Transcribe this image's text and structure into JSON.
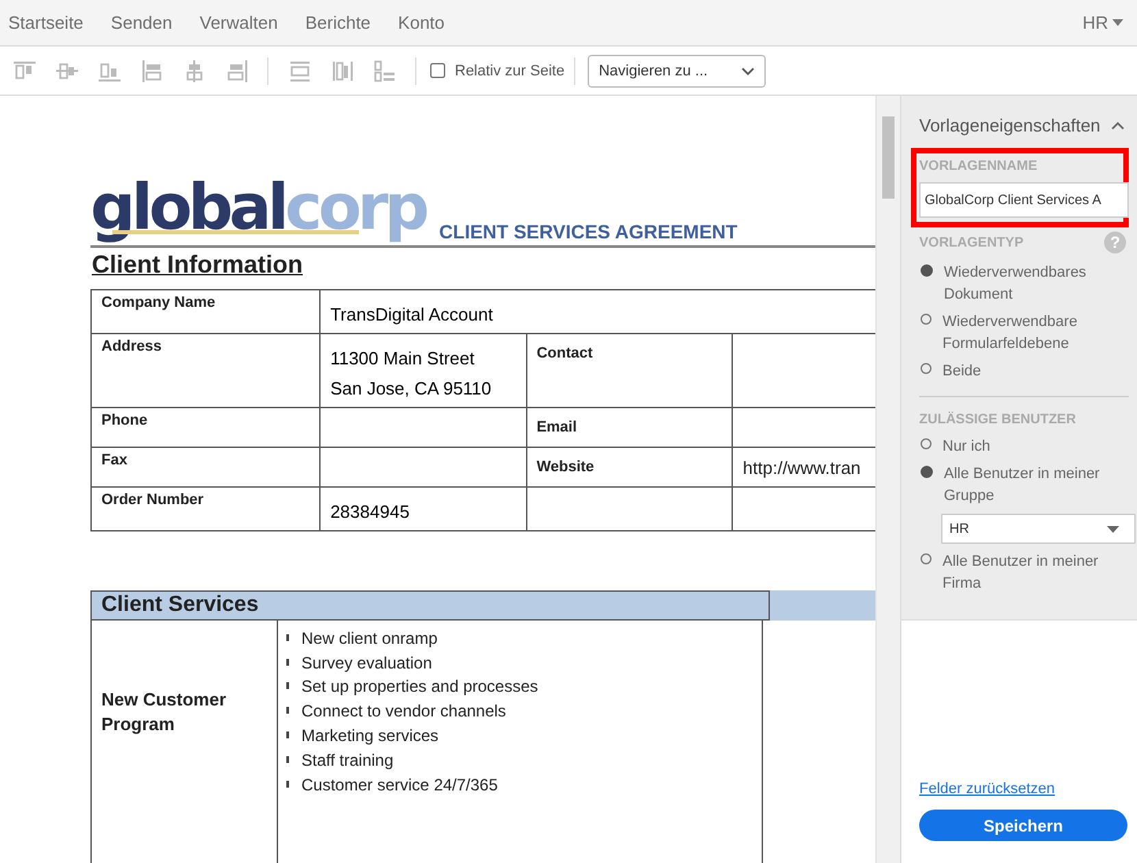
{
  "nav": {
    "items": [
      "Startseite",
      "Senden",
      "Verwalten",
      "Berichte",
      "Konto"
    ],
    "user_menu": "HR"
  },
  "toolbar": {
    "relative_checkbox": {
      "label": "Relativ zur Seite",
      "checked": false
    },
    "navigate_select": "Navigieren zu ..."
  },
  "document": {
    "logo": {
      "part_1": "global",
      "part_2": "corp"
    },
    "title": "CLIENT SERVICES AGREEMENT",
    "section_1": "Client Information",
    "client_info": [
      {
        "kind": "full",
        "label": "Company Name",
        "value": [
          "TransDigital Account"
        ]
      },
      {
        "kind": "split",
        "label": "Address",
        "value": [
          "11300 Main Street",
          "San Jose, CA  95110"
        ],
        "label_2": "Contact"
      },
      {
        "kind": "split",
        "label": "Phone",
        "label_2": "Email"
      },
      {
        "kind": "split",
        "label": "Fax",
        "label_2": "Website",
        "value_2": "http://www.tran"
      },
      {
        "kind": "split",
        "label": "Order Number",
        "value": [
          "28384945"
        ]
      }
    ],
    "section_2": "Client Services",
    "services": [
      {
        "label": "New Customer Program",
        "items": [
          "New client onramp",
          "Survey evaluation",
          "Set up properties and processes",
          "Connect to vendor channels",
          "Marketing services",
          "Staff training",
          "Customer service 24/7/365"
        ]
      }
    ]
  },
  "panel": {
    "title": "Vorlageneigenschaften",
    "expanded": true,
    "name_section": {
      "label": "VORLAGENNAME",
      "value": "GlobalCorp Client Services A",
      "highlighted": true
    },
    "type_section": {
      "label": "VORLAGENTYP",
      "help": "?",
      "options": [
        {
          "label": "Wiederverwendbares Dokument",
          "selected": true
        },
        {
          "label": "Wiederverwendbare Formularfeldebene",
          "selected": false
        },
        {
          "label": "Beide",
          "selected": false
        }
      ]
    },
    "users_section": {
      "label": "ZULÄSSIGE BENUTZER",
      "options": [
        {
          "label": "Nur ich",
          "selected": false
        },
        {
          "label": "Alle Benutzer in meiner Gruppe",
          "selected": true,
          "dropdown": "HR"
        },
        {
          "label": "Alle Benutzer in meiner Firma",
          "selected": false
        }
      ]
    },
    "reset_link": "Felder zurücksetzen",
    "save_button": "Speichern"
  }
}
